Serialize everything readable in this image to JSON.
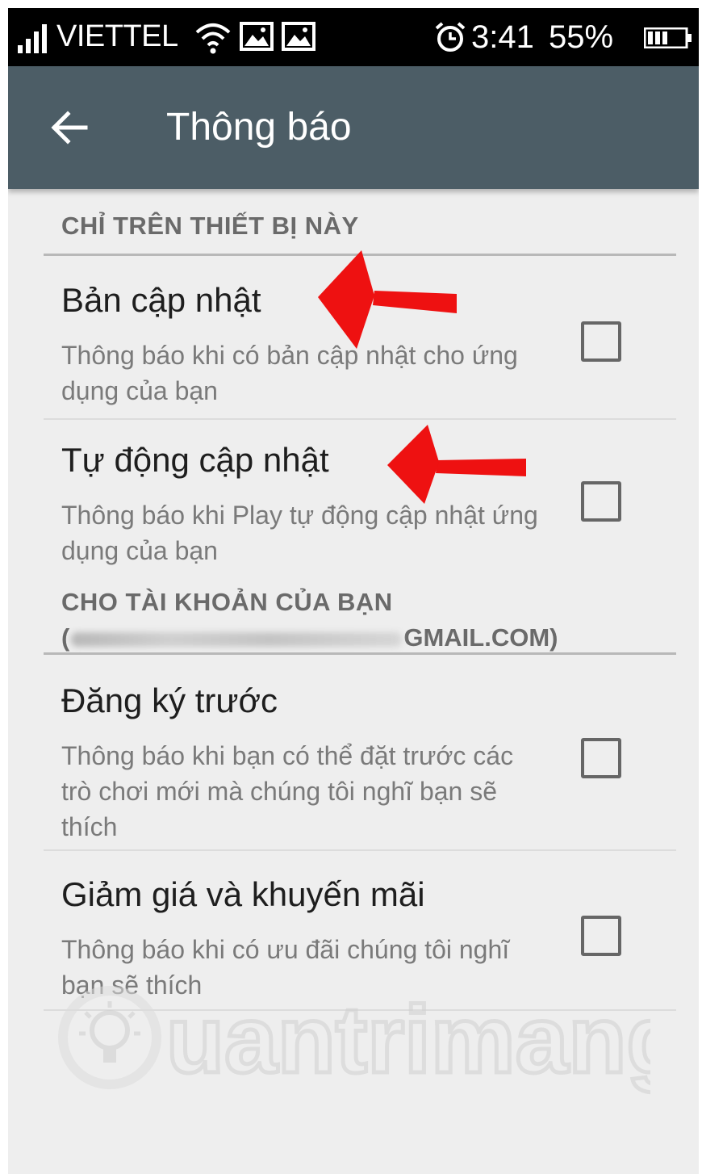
{
  "status_bar": {
    "carrier": "VIETTEL",
    "time": "3:41",
    "battery_percent": "55%",
    "icons": [
      "signal-icon",
      "wifi-icon",
      "image-icon",
      "image-icon",
      "alarm-icon",
      "battery-icon"
    ]
  },
  "app_bar": {
    "title": "Thông báo",
    "back_icon": "arrow-left-icon",
    "color": "#4c5d66"
  },
  "sections": [
    {
      "header": "CHỈ TRÊN THIẾT BỊ NÀY",
      "items": [
        {
          "title": "Bản cập nhật",
          "summary": "Thông báo khi có bản cập nhật cho ứng dụng của bạn",
          "checked": false
        },
        {
          "title": "Tự động cập nhật",
          "summary": "Thông báo khi Play tự động cập nhật ứng dụng của bạn",
          "checked": false
        }
      ]
    },
    {
      "header": "CHO TÀI KHOẢN CỦA BẠN",
      "account_open": "(",
      "account_suffix": "GMAIL.COM)",
      "items": [
        {
          "title": "Đăng ký trước",
          "summary": "Thông báo khi bạn có thể đặt trước các trò chơi mới mà chúng tôi nghĩ bạn sẽ thích",
          "checked": false
        },
        {
          "title": "Giảm giá và khuyến mãi",
          "summary": "Thông báo khi có ưu đãi chúng tôi nghĩ bạn sẽ thích",
          "checked": false
        }
      ]
    }
  ],
  "annotations": {
    "arrow_color": "#ee1111"
  },
  "watermark": {
    "text": "uantrimang"
  }
}
